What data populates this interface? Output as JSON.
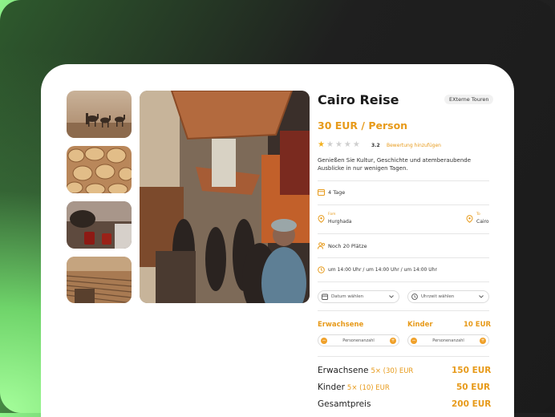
{
  "tour": {
    "title": "Cairo Reise",
    "tag": "EXterne Touren",
    "price": "30 EUR / Person",
    "rating_value": "3.2",
    "rating_stars": 1,
    "rating_link": "Bewertung hinzufügen",
    "description": "Genießen Sie Kultur, Geschichte und atemberaubende Ausblicke in nur wenigen Tagen."
  },
  "details": {
    "duration": "4 Tage",
    "from_label": "Fom",
    "from_value": "Hurghada",
    "to_label": "To",
    "to_value": "Cairo",
    "seats": "Noch 20 Plätze",
    "times": "um 14:00 Uhr  /  um 14:00 Uhr  /  um 14:00 Uhr"
  },
  "selectors": {
    "date_label": "Datum wählen",
    "time_label": "Uhrzeit wählen"
  },
  "participants": {
    "adults_label": "Erwachsene",
    "children_label": "Kinder",
    "children_price": "10 EUR",
    "adults_stepper": "Personenanzahl",
    "children_stepper": "Personenanzahl"
  },
  "summary": {
    "adults_label": "Erwachsene",
    "adults_calc": "5× (30) EUR",
    "adults_total": "150  EUR",
    "children_label": "Kinder",
    "children_calc": "5× (10) EUR",
    "children_total": "50  EUR",
    "total_label": "Gesamtpreis",
    "total_value": "200  EUR"
  },
  "colors": {
    "accent": "#e79a1a",
    "star": "#f3b11f"
  }
}
